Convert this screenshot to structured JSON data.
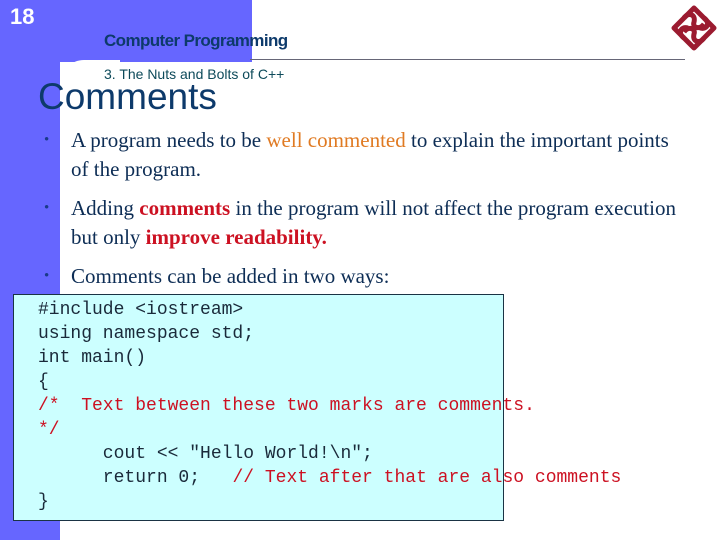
{
  "slide": {
    "page_number": "18",
    "course_title": "Computer Programming",
    "chapter": "3. The Nuts and Bolts of C++",
    "title": "Comments",
    "logo_icon": "university-knot-logo-icon"
  },
  "colors": {
    "band": "#6666ff",
    "title": "#0d3a6b",
    "highlight_orange": "#e07a22",
    "highlight_red": "#cc1122",
    "code_bg": "#ccffff"
  },
  "bullets": [
    {
      "pre": "A program needs to be ",
      "highlight": "well commented",
      "post": " to explain the important points of the program."
    },
    {
      "pre": "Adding ",
      "highlight": "comments",
      "mid": " in the program will not affect the program execution but only ",
      "highlight2": "improve readability."
    },
    {
      "pre": "Comments can be added in two ways:"
    }
  ],
  "code": {
    "lines": [
      {
        "text": "#include <iostream>"
      },
      {
        "text": "using namespace std;"
      },
      {
        "text": "int main()"
      },
      {
        "text": "{"
      },
      {
        "comment": "/*  Text between these two marks are comments."
      },
      {
        "comment": "*/"
      },
      {
        "text": "      cout << \"Hello World!\\n\";"
      },
      {
        "text": "      return 0;   ",
        "comment": "// Text after that are also comments"
      },
      {
        "text": "}"
      }
    ]
  }
}
